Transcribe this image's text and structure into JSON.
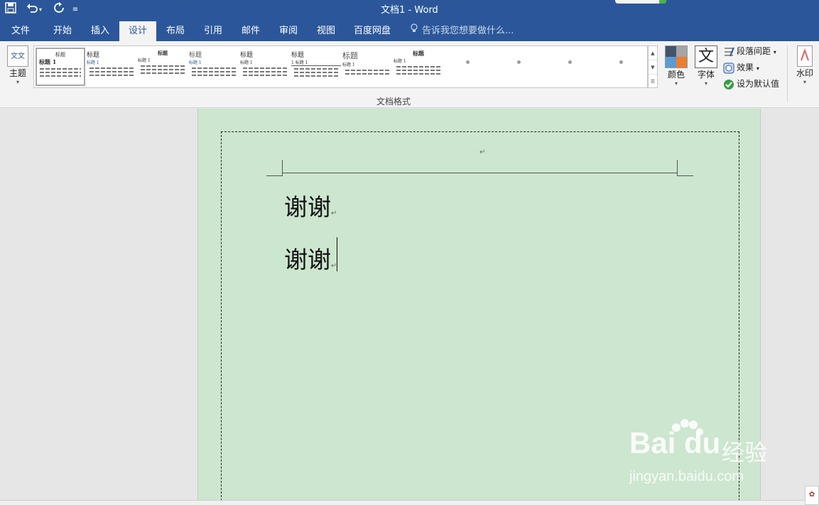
{
  "titlebar": {
    "title": "文档1 - Word",
    "icons": {
      "save": "save-icon",
      "undo": "undo-icon",
      "redo": "redo-icon",
      "customize": "customize-qat-icon"
    },
    "undo_caret": "▾",
    "customize_glyph": "≡"
  },
  "tabs": [
    {
      "label": "文件"
    },
    {
      "label": "开始"
    },
    {
      "label": "插入"
    },
    {
      "label": "设计",
      "active": true
    },
    {
      "label": "布局"
    },
    {
      "label": "引用"
    },
    {
      "label": "邮件"
    },
    {
      "label": "审阅"
    },
    {
      "label": "视图"
    },
    {
      "label": "百度网盘"
    }
  ],
  "tell_me": {
    "placeholder": "告诉我您想要做什么..."
  },
  "ribbon": {
    "theme_label": "主题",
    "theme_icon_text": "文文",
    "gallery": [
      {
        "title": "标题",
        "subtitle": "标题 1"
      },
      {
        "title": "标题",
        "subtitle": "标题 1"
      },
      {
        "title": "标题",
        "subtitle": "标题 1"
      },
      {
        "title": "标题",
        "subtitle": "标题 1"
      },
      {
        "title": "标题",
        "subtitle": "标题 1"
      },
      {
        "title": "标题",
        "subtitle": "1 标题 1"
      },
      {
        "title": "标题",
        "subtitle": "标题 1"
      },
      {
        "title": "标题",
        "subtitle": "标题 1"
      }
    ],
    "group_label": "文档格式",
    "colors_label": "颜色",
    "fonts_label": "字体",
    "fonts_icon_text": "文",
    "paragraph_spacing": "段落间距",
    "effects": "效果",
    "set_default": "设为默认值",
    "watermark": "水印",
    "caret": "▾",
    "scroll_up": "▲",
    "scroll_down": "▼",
    "scroll_more": "☰"
  },
  "document": {
    "header_mark": "↵",
    "lines": [
      "谢谢",
      "谢谢"
    ],
    "para_mark": "↵"
  },
  "baidu": {
    "logo_bai": "Bai du",
    "logo_cn": "经验",
    "url": "jingyan.baidu.com"
  },
  "colors": {
    "title_bar": "#2b579a",
    "page_color": "#cde6cf",
    "ribbon_bg": "#f3f3f3"
  }
}
